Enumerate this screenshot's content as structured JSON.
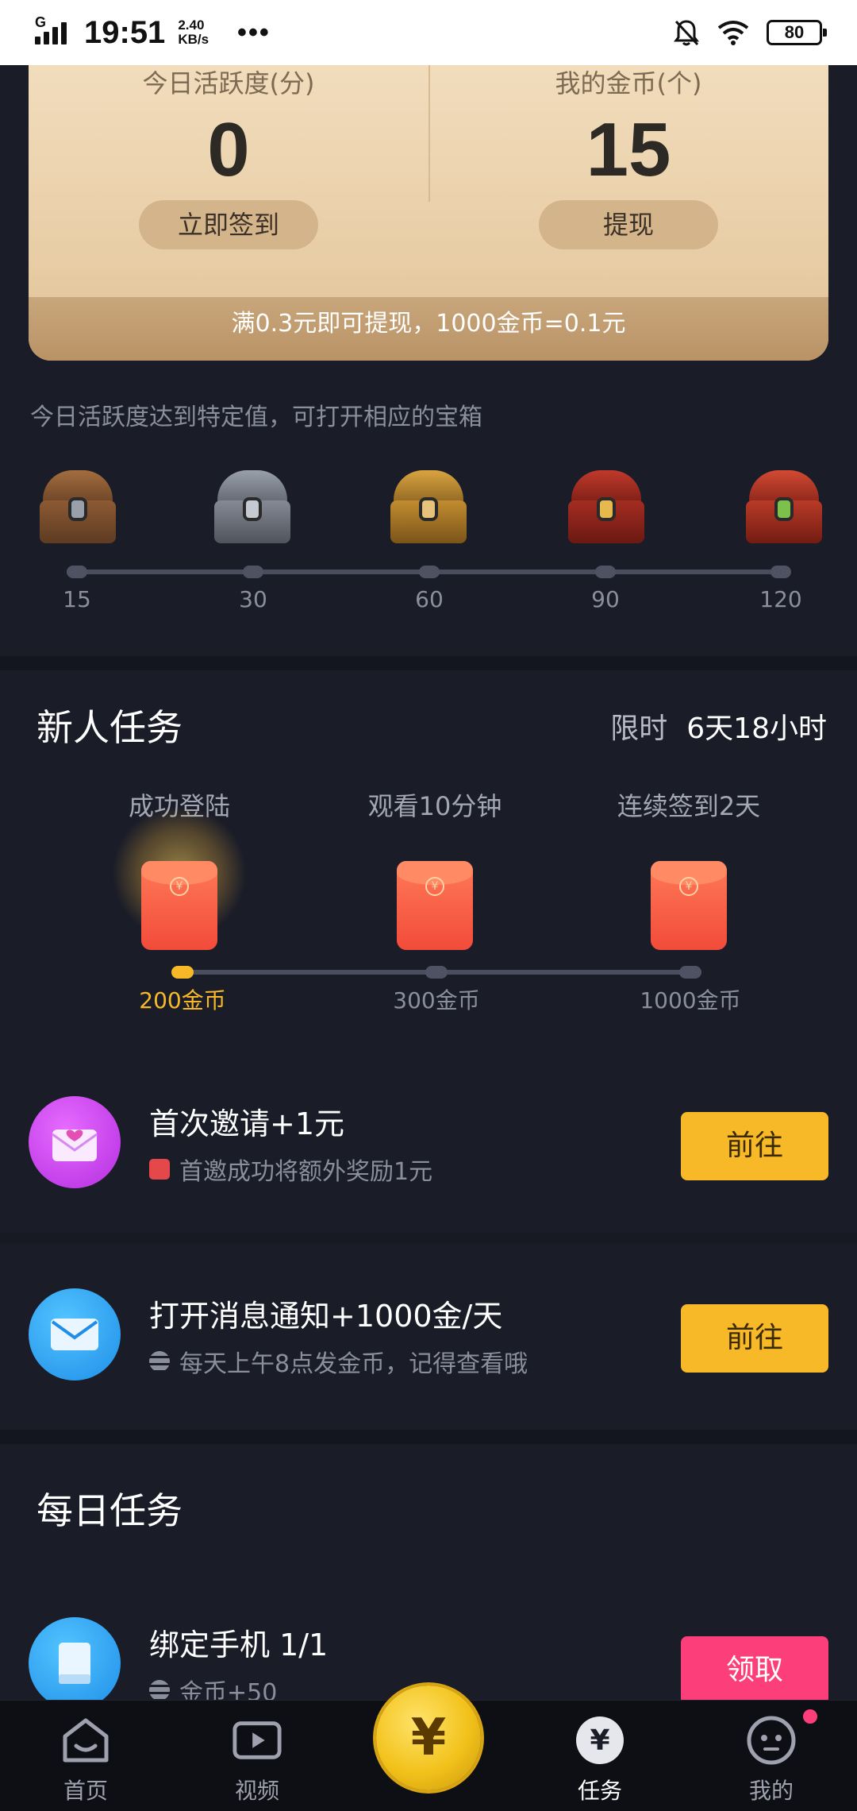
{
  "status_bar": {
    "network": "G",
    "time": "19:51",
    "speed_value": "2.40",
    "speed_unit": "KB/s",
    "dots": "•••",
    "battery": "80"
  },
  "summary": {
    "activity_label": "今日活跃度(分)",
    "activity_value": "0",
    "checkin_button": "立即签到",
    "coins_label": "我的金币(个)",
    "coins_value": "15",
    "withdraw_button": "提现",
    "footer_note": "满0.3元即可提现，1000金币=0.1元"
  },
  "chests": {
    "hint": "今日活跃度达到特定值，可打开相应的宝箱",
    "thresholds": [
      "15",
      "30",
      "60",
      "90",
      "120"
    ]
  },
  "newbie": {
    "title": "新人任务",
    "limit_label": "限时",
    "limit_value": "6天18小时",
    "steps": [
      {
        "title": "成功登陆",
        "reward": "200金币"
      },
      {
        "title": "观看10分钟",
        "reward": "300金币"
      },
      {
        "title": "连续签到2天",
        "reward": "1000金币"
      }
    ]
  },
  "tasks": [
    {
      "title": "首次邀请+1元",
      "subtitle": "首邀成功将额外奖励1元",
      "button": "前往"
    },
    {
      "title": "打开消息通知+1000金/天",
      "subtitle": "每天上午8点发金币，记得查看哦",
      "button": "前往"
    }
  ],
  "daily": {
    "title": "每日任务",
    "tasks": [
      {
        "title": "绑定手机 1/1",
        "subtitle": "金币+50",
        "button": "领取"
      }
    ]
  },
  "bottom_nav": {
    "items": [
      {
        "label": "首页",
        "icon": "home-icon"
      },
      {
        "label": "视频",
        "icon": "video-icon"
      },
      {
        "label": "任务",
        "icon": "task-yen-icon"
      },
      {
        "label": "我的",
        "icon": "profile-face-icon"
      }
    ],
    "center_symbol": "¥"
  },
  "colors": {
    "accent_yellow": "#f7b927",
    "accent_pink": "#fc3f7a",
    "background": "#1a1c28"
  }
}
